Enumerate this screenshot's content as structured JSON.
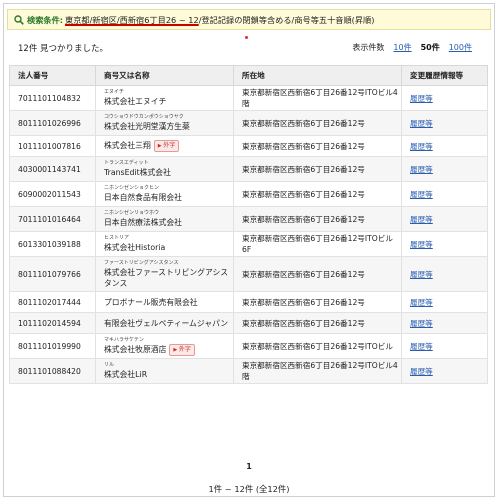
{
  "search": {
    "label": "検索条件:",
    "condition_underlined": "東京都/新宿区/西新宿6丁目26 ~ 12",
    "condition_rest": "/登記記録の閉鎖等含める/商号等五十音順(昇順)"
  },
  "results": {
    "count_text": "12件 見つかりました。",
    "pagesize_label": "表示件数",
    "pagesize_options": [
      "10件",
      "50件",
      "100件"
    ],
    "pagesize_selected": "50件"
  },
  "table": {
    "headers": [
      "法人番号",
      "商号又は名称",
      "所在地",
      "変更履歴情報等"
    ],
    "rows": [
      {
        "number": "7011101104832",
        "kana": "エヌイチ",
        "name": "株式会社エヌイチ",
        "foreign": "",
        "address": "東京都新宿区西新宿6丁目26番12号ITOビル4階",
        "history": "履歴等"
      },
      {
        "number": "8011101026996",
        "kana": "コウショウドウカンポウショウヤク",
        "name": "株式会社光明堂漢方生薬",
        "foreign": "",
        "address": "東京都新宿区西新宿6丁目26番12号",
        "history": "履歴等"
      },
      {
        "number": "1011101007816",
        "kana": "",
        "name": "株式会社三翔",
        "foreign": "外字",
        "address": "東京都新宿区西新宿6丁目26番12号",
        "history": "履歴等"
      },
      {
        "number": "4030001143741",
        "kana": "トランスエディット",
        "name": "TransEdit株式会社",
        "foreign": "",
        "address": "東京都新宿区西新宿6丁目26番12号",
        "history": "履歴等"
      },
      {
        "number": "6090002011543",
        "kana": "ニホンシゼンショクヒン",
        "name": "日本自然食品有限会社",
        "foreign": "",
        "address": "東京都新宿区西新宿6丁目26番12号",
        "history": "履歴等"
      },
      {
        "number": "7011101016464",
        "kana": "ニホンシゼンリョウホウ",
        "name": "日本自然療法株式会社",
        "foreign": "",
        "address": "東京都新宿区西新宿6丁目26番12号",
        "history": "履歴等"
      },
      {
        "number": "6013301039188",
        "kana": "ヒストリア",
        "name": "株式会社Historia",
        "foreign": "",
        "address": "東京都新宿区西新宿6丁目26番12号ITOビル6F",
        "history": "履歴等"
      },
      {
        "number": "8011101079766",
        "kana": "ファーストリビングアシスタンス",
        "name": "株式会社ファーストリビングアシスタンス",
        "foreign": "",
        "address": "東京都新宿区西新宿6丁目26番12号",
        "history": "履歴等"
      },
      {
        "number": "8011102017444",
        "kana": "",
        "name": "プロボナール販売有限会社",
        "foreign": "",
        "address": "東京都新宿区西新宿6丁目26番12号",
        "history": "履歴等"
      },
      {
        "number": "1011102014594",
        "kana": "",
        "name": "有限会社ヴェルペティームジャパン",
        "foreign": "",
        "address": "東京都新宿区西新宿6丁目26番12号",
        "history": "履歴等"
      },
      {
        "number": "8011101019990",
        "kana": "マキハラサケテン",
        "name": "株式会社牧原酒店",
        "foreign": "外字",
        "address": "東京都新宿区西新宿6丁目26番12号ITOビル",
        "history": "履歴等"
      },
      {
        "number": "8011101088420",
        "kana": "リル",
        "name": "株式会社LiR",
        "foreign": "",
        "address": "東京都新宿区西新宿6丁目26番12号ITOビル4階",
        "history": "履歴等"
      }
    ]
  },
  "pagination": {
    "current_page": "1",
    "summary": "1件 ~ 12件 (全12件)"
  },
  "colors": {
    "condition_bg": "#fffbd8",
    "label_green": "#2a7a2a",
    "link_blue": "#2a5db0",
    "underline_red": "#cc0000"
  }
}
